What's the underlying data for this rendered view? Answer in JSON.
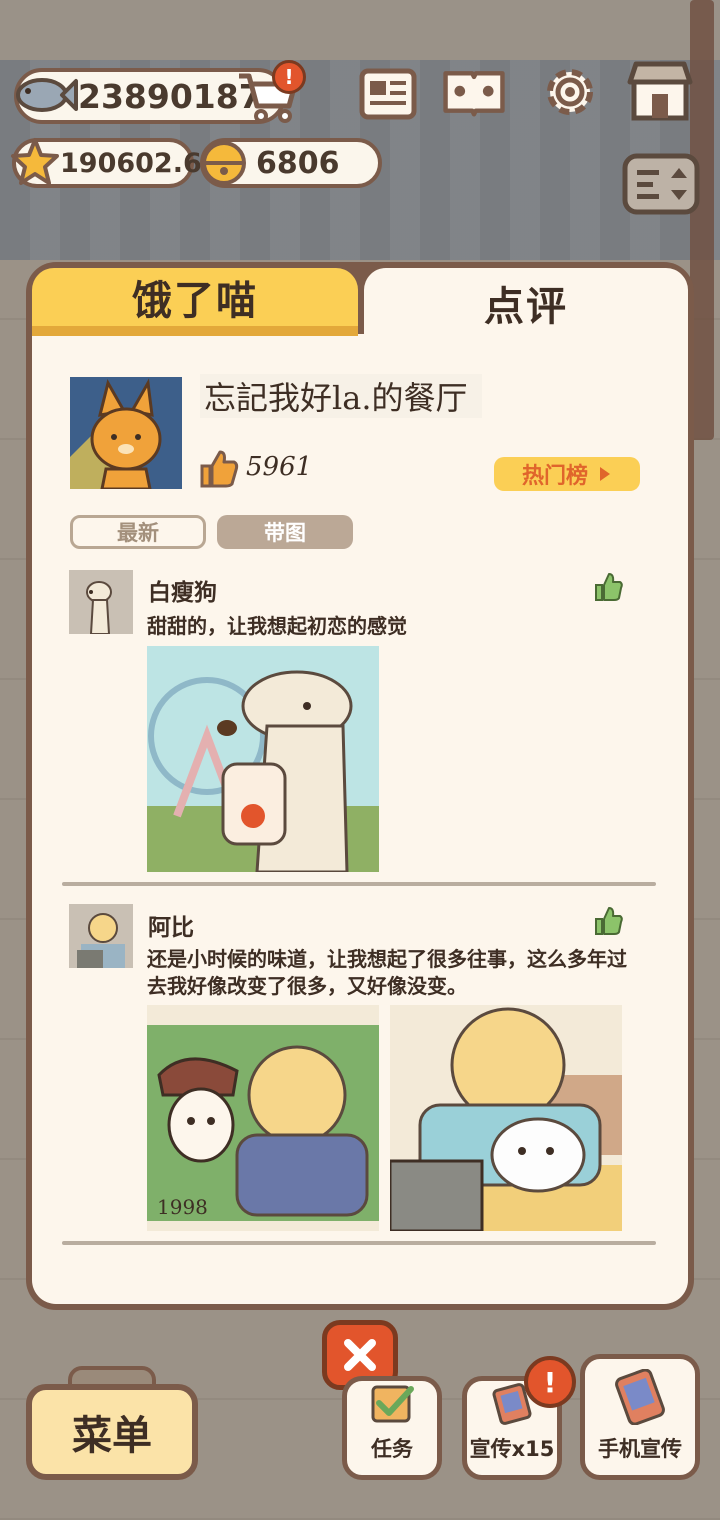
{
  "hud": {
    "fish_count": "23890187",
    "star_rating": "190602.6",
    "bell_count": "6806",
    "cart_alert": "!"
  },
  "tabs": {
    "left": "饿了喵",
    "right": "点评"
  },
  "restaurant": {
    "name": "忘記我好la.的餐厅",
    "likes": "5961",
    "hot_list_label": "热门榜"
  },
  "filters": {
    "newest": "最新",
    "with_pictures": "带图"
  },
  "reviews": [
    {
      "author": "白瘦狗",
      "text": "甜甜的，让我想起初恋的感觉"
    },
    {
      "author": "阿比",
      "text": "还是小时候的味道，让我想起了很多往事，这么多年过去我好像改变了很多，又好像没变。",
      "photo_caption": "1998"
    }
  ],
  "bottom": {
    "menu_label": "菜单",
    "task_label": "任务",
    "promo_label": "宣传x15",
    "phone_promo_label": "手机宣传",
    "promo_alert": "!"
  },
  "colors": {
    "panel_border": "#7b5b4a",
    "panel_bg": "#fdf6ec",
    "tab_active": "#fbcf55",
    "alert": "#e2552c",
    "like_green": "#8cc36a"
  }
}
